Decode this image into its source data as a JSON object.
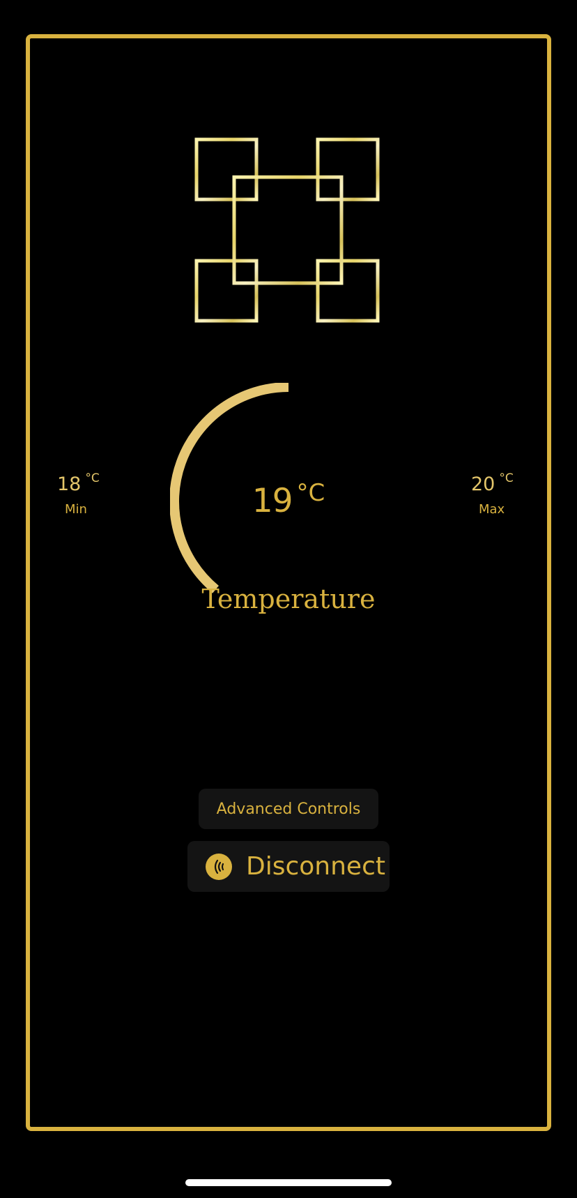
{
  "app": {
    "accent_color": "#d9b23f",
    "logo_color": "#f2ea9a"
  },
  "logo": {
    "icon": "interlocking-squares-logo"
  },
  "temperature": {
    "current_value": "19",
    "unit": "°C",
    "label": "Temperature",
    "gauge_level": 0.5
  },
  "min": {
    "value": "18",
    "unit": "°C",
    "label": "Min"
  },
  "max": {
    "value": "20",
    "unit": "°C",
    "label": "Max"
  },
  "buttons": {
    "advanced_label": "Advanced Controls",
    "disconnect_label": "Disconnect",
    "disconnect_icon": "signal-waves-icon"
  }
}
